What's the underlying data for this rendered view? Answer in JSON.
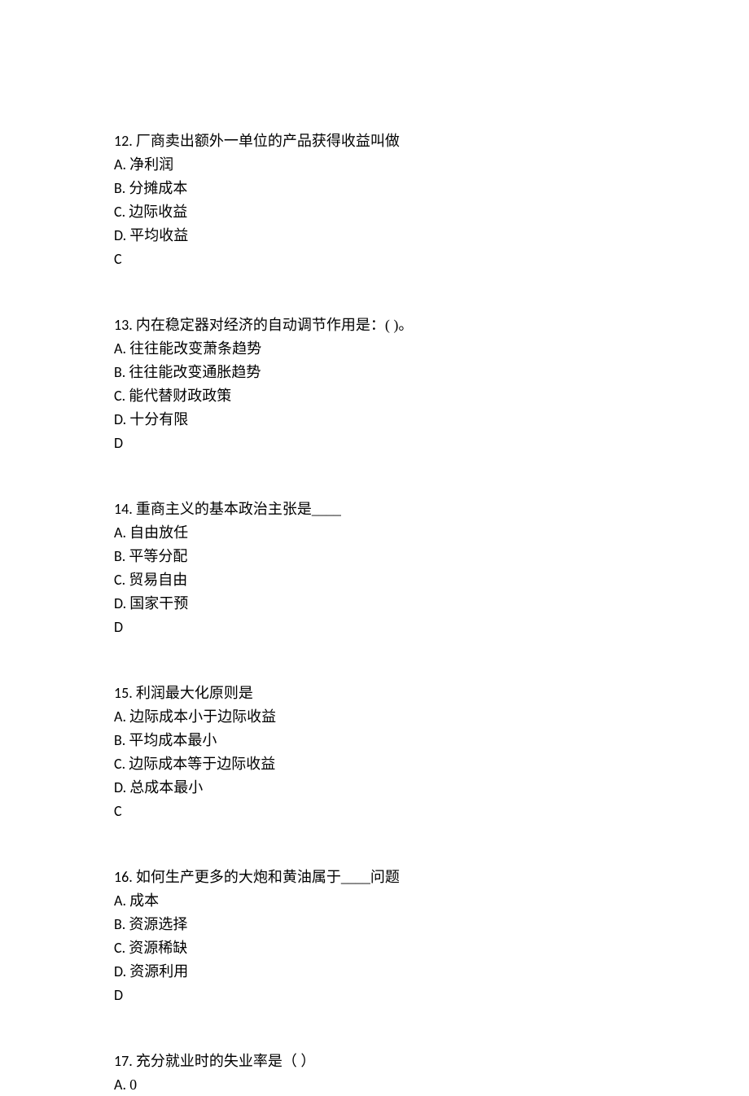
{
  "questions": [
    {
      "number": "12. ",
      "text": "厂商卖出额外一单位的产品获得收益叫做",
      "options": [
        {
          "letter": "A. ",
          "text": "净利润"
        },
        {
          "letter": "B. ",
          "text": "分摊成本"
        },
        {
          "letter": "C. ",
          "text": "边际收益"
        },
        {
          "letter": "D. ",
          "text": "平均收益"
        }
      ],
      "answer": "C"
    },
    {
      "number": "13. ",
      "text": "内在稳定器对经济的自动调节作用是：( )。",
      "options": [
        {
          "letter": "A. ",
          "text": "往往能改变萧条趋势"
        },
        {
          "letter": "B. ",
          "text": "往往能改变通胀趋势"
        },
        {
          "letter": "C. ",
          "text": "能代替财政政策"
        },
        {
          "letter": "D. ",
          "text": "十分有限"
        }
      ],
      "answer": "D"
    },
    {
      "number": "14. ",
      "text": "重商主义的基本政治主张是____",
      "options": [
        {
          "letter": "A. ",
          "text": "自由放任"
        },
        {
          "letter": "B. ",
          "text": "平等分配"
        },
        {
          "letter": "C. ",
          "text": "贸易自由"
        },
        {
          "letter": "D. ",
          "text": "国家干预"
        }
      ],
      "answer": "D"
    },
    {
      "number": "15. ",
      "text": "利润最大化原则是",
      "options": [
        {
          "letter": "A. ",
          "text": "边际成本小于边际收益"
        },
        {
          "letter": "B. ",
          "text": "平均成本最小"
        },
        {
          "letter": "C. ",
          "text": "边际成本等于边际收益"
        },
        {
          "letter": "D. ",
          "text": "总成本最小"
        }
      ],
      "answer": "C"
    },
    {
      "number": "16. ",
      "text": "如何生产更多的大炮和黄油属于____问题",
      "options": [
        {
          "letter": "A. ",
          "text": "成本"
        },
        {
          "letter": "B. ",
          "text": "资源选择"
        },
        {
          "letter": "C. ",
          "text": "资源稀缺"
        },
        {
          "letter": "D. ",
          "text": "资源利用"
        }
      ],
      "answer": "D"
    },
    {
      "number": "17. ",
      "text": "充分就业时的失业率是（ ）",
      "options": [
        {
          "letter": "A. ",
          "text": "0"
        }
      ],
      "answer": ""
    }
  ]
}
